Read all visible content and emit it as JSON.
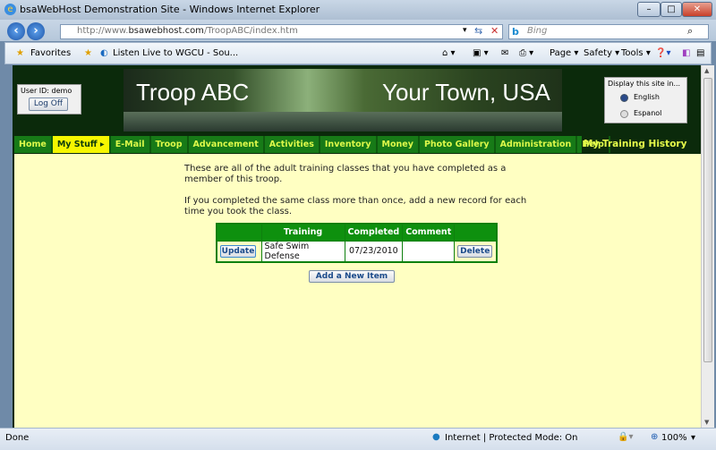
{
  "window": {
    "title": "bsaWebHost Demonstration Site - Windows Internet Explorer"
  },
  "address": {
    "url_prefix": "http://www.",
    "url_domain": "bsawebhost.com",
    "url_path": "/TroopABC/index.htm",
    "search_placeholder": "Bing"
  },
  "favorites": {
    "label": "Favorites",
    "tab": "Listen Live to WGCU - Sou...",
    "page": "Page",
    "safety": "Safety",
    "tools": "Tools"
  },
  "header": {
    "title_left": "Troop ABC",
    "title_right": "Your Town, USA",
    "user_label": "User ID:  demo",
    "logoff": "Log Off",
    "lang_title": "Display this site in...",
    "lang_options": [
      "English",
      "Espanol"
    ],
    "lang_selected": "English"
  },
  "nav": {
    "items": [
      "Home",
      "My Stuff",
      "E-Mail",
      "Troop",
      "Advancement",
      "Activities",
      "Inventory",
      "Money",
      "Photo Gallery",
      "Administration",
      "Help"
    ],
    "active": "My Stuff",
    "page_title": "My Training History"
  },
  "content": {
    "para1": "These are all of the adult training classes that you have completed as a member of this troop.",
    "para2": "If you completed the same class more than once, add a new record for each time you took the class.",
    "table": {
      "headers": [
        "",
        "Training",
        "Completed",
        "Comment",
        ""
      ],
      "rows": [
        {
          "update": "Update",
          "training": "Safe Swim Defense",
          "completed": "07/23/2010",
          "comment": "",
          "delete": "Delete"
        }
      ]
    },
    "add_button": "Add a New Item"
  },
  "status": {
    "left": "Done",
    "zone": "Internet | Protected Mode: On",
    "zoom": "100%"
  },
  "colors": {
    "nav_bg": "#177a17",
    "nav_text": "#ddf94a",
    "active_nav": "#f6f600",
    "content_bg": "#ffffc2",
    "header_bg": "#0b2a0b",
    "table_header": "#0e900e"
  }
}
